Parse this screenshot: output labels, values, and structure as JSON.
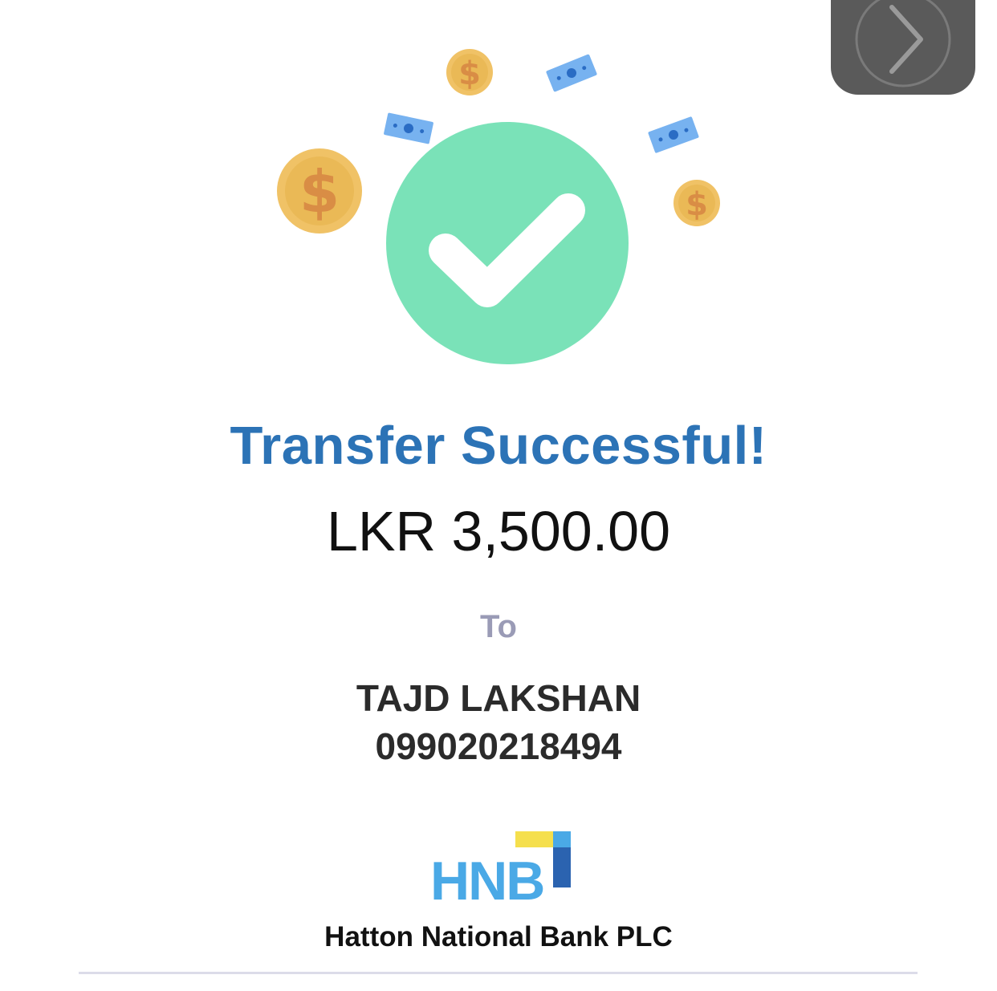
{
  "status": {
    "title": "Transfer Successful!",
    "amount": "LKR 3,500.00"
  },
  "recipient": {
    "to_label": "To",
    "name": "TAJD LAKSHAN",
    "account_number": "099020218494"
  },
  "bank": {
    "logo_text": "HNB",
    "name": "Hatton National Bank PLC"
  },
  "icons": {
    "success": "check-circle-icon",
    "coin": "dollar-coin-icon",
    "bill": "banknote-icon",
    "next": "chevron-right-icon"
  },
  "colors": {
    "title": "#2c73b6",
    "success_circle": "#7ae2b8",
    "coin": "#f0c266",
    "bill": "#77b2f0",
    "hnb_blue": "#4aa9e6",
    "hnb_yellow": "#f5df4d",
    "hnb_dark_blue": "#2b63b0"
  }
}
